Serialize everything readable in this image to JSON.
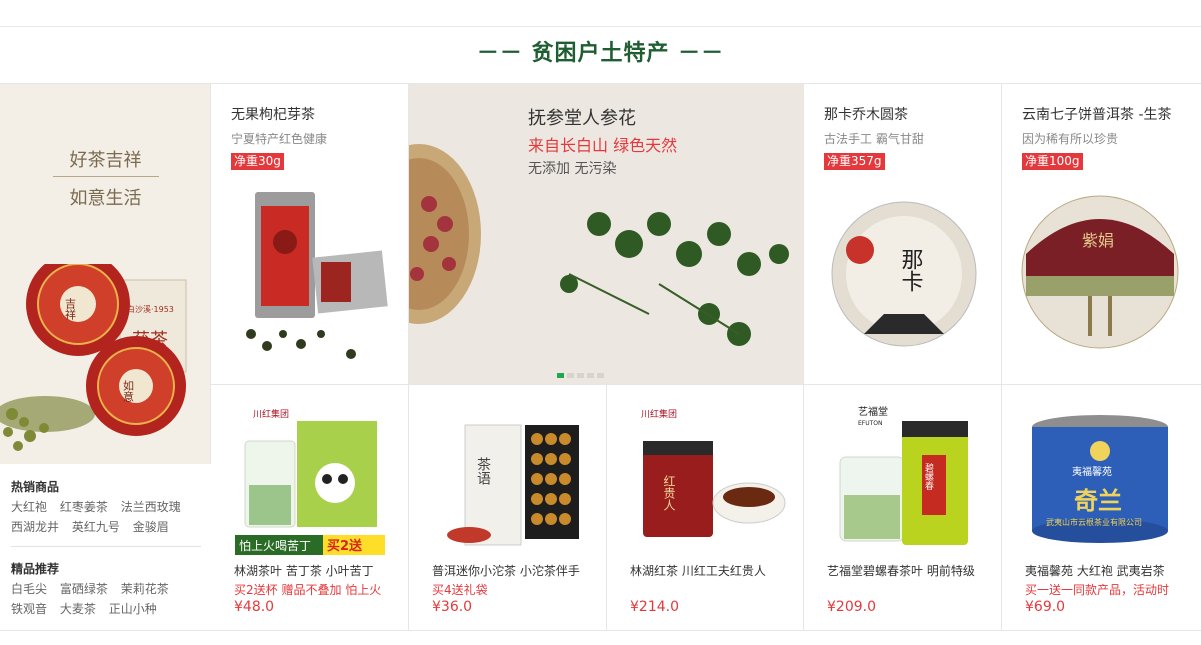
{
  "section_title": "－－ 贫困户土特产 －－",
  "left": {
    "slogan_top": "好茶吉祥",
    "slogan_bottom": "如意生活",
    "hot_title": "热销商品",
    "hot_items_row1": [
      "大红袍",
      "红枣姜茶",
      "法兰西玫瑰"
    ],
    "hot_items_row2": [
      "西湖龙井",
      "英红九号",
      "金骏眉"
    ],
    "best_title": "精品推荐",
    "best_items_row1": [
      "白毛尖",
      "富硒绿茶",
      "茉莉花茶"
    ],
    "best_items_row2": [
      "铁观音",
      "大麦茶",
      "正山小种"
    ],
    "image_text": {
      "tin_label": "白沙溪·1953",
      "tin_big": "茯茶",
      "cake1": "吉祥",
      "cake2": "如意"
    }
  },
  "top_products": [
    {
      "name": "无果枸杞芽茶",
      "subtitle": "宁夏特产红色健康",
      "badge": "净重30g"
    },
    {
      "name": "那卡乔木圆茶",
      "subtitle": "古法手工 霸气甘甜",
      "badge": "净重357g"
    },
    {
      "name": "云南七子饼普洱茶 -生茶",
      "subtitle": "因为稀有所以珍贵",
      "badge": "净重100g"
    }
  ],
  "banner": {
    "title": "抚参堂人参花",
    "red_text": "来自长白山 绿色天然",
    "gray_text": "无添加 无污染",
    "slides_total": 5,
    "slide_active": 1
  },
  "bottom_products": [
    {
      "name": "林湖茶叶 苦丁茶 小叶苦丁",
      "promo": "买2送杯 赠品不叠加 怕上火",
      "price": "¥48.0",
      "image_text": {
        "brand": "川红集团",
        "slogan": "怕上火喝苦丁",
        "offer": "买2送"
      }
    },
    {
      "name": "普洱迷你小沱茶 小沱茶伴手",
      "promo": "买4送礼袋",
      "price": "¥36.0",
      "image_text": {
        "box": "茶语"
      }
    },
    {
      "name": "林湖红茶 川红工夫红贵人",
      "promo": "",
      "price": "¥214.0",
      "image_text": {
        "brand": "川红集团",
        "tin": "红贵人"
      }
    },
    {
      "name": "艺福堂碧螺春茶叶 明前特级",
      "promo": "",
      "price": "¥209.0",
      "image_text": {
        "brand": "艺福堂",
        "brand_en": "EFUTON",
        "tin": "碧螺春"
      }
    },
    {
      "name": "夷福馨苑 大红袍 武夷岩茶",
      "promo": "买一送一同款产品，活动时",
      "price": "¥69.0",
      "image_text": {
        "brand": "夷福馨苑",
        "tin_big": "奇兰",
        "tin_small": "武夷山市云根茶业有限公司"
      }
    }
  ],
  "image_text": {
    "cake_naka": "那卡",
    "cake_ziju": "紫娟"
  },
  "colors": {
    "title_green": "#1f5d32",
    "accent_red": "#e4393c",
    "left_bg": "#f4efe6",
    "dot_active": "#1fa84f"
  }
}
